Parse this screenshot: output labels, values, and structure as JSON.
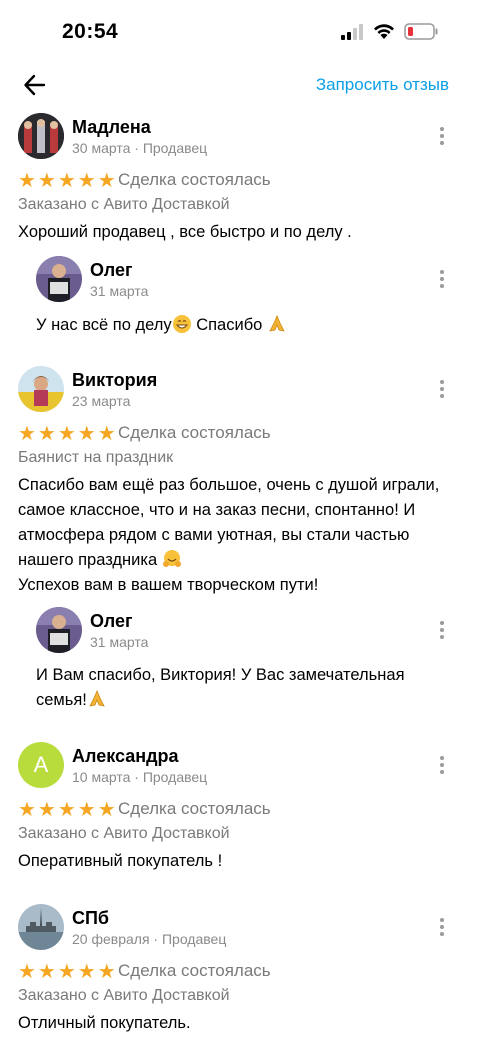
{
  "status_bar": {
    "time": "20:54"
  },
  "header": {
    "request_review": "Запросить отзыв"
  },
  "reviews": [
    {
      "name": "Мадлена",
      "meta": "30 марта · Продавец",
      "stars": "★★★★★",
      "deal": "Сделка состоялась",
      "subtitle": "Заказано с Авито Доставкой",
      "text": "Хороший продавец , все быстро и по делу .",
      "reply": {
        "name": "Олег",
        "meta": "31 марта",
        "text": "У нас всё по делу",
        "text2": " Спасибо "
      }
    },
    {
      "name": "Виктория",
      "meta": "23 марта",
      "stars": "★★★★★",
      "deal": "Сделка состоялась",
      "subtitle": "Баянист на праздник",
      "text_lines": [
        "Спасибо вам ещё раз большое, очень с душой играли,",
        "самое классное, что и на заказ песни, спонтанно!  И",
        "атмосфера рядом с вами уютная, вы стали частью",
        "нашего праздника ",
        "Успехов вам в вашем творческом пути!"
      ],
      "reply": {
        "name": "Олег",
        "meta": "31 марта",
        "text_line1": "И Вам спасибо, Виктория! У Вас замечательная",
        "text_line2": "семья!"
      }
    },
    {
      "name": "Александра",
      "avatar_letter": "А",
      "meta": "10 марта · Продавец",
      "stars": "★★★★★",
      "deal": "Сделка состоялась",
      "subtitle": "Заказано с Авито Доставкой",
      "text": "Оперативный покупатель !"
    },
    {
      "name": "СПб",
      "meta": "20 февраля · Продавец",
      "stars": "★★★★★",
      "deal": "Сделка состоялась",
      "subtitle": "Заказано с Авито Доставкой",
      "text": "Отличный покупатель."
    }
  ],
  "colors": {
    "accent": "#0aa0e8",
    "star": "#f5a623",
    "avatar_green": "#b8dc3c"
  }
}
